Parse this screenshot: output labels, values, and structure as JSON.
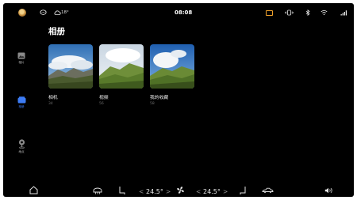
{
  "status_bar": {
    "time": "08:08",
    "weather_temp": "18°",
    "icons": [
      "avatar",
      "messages-icon",
      "weather-icon",
      "dashcam-icon",
      "vibrate-icon",
      "bluetooth-icon",
      "wifi-icon",
      "signal-icon"
    ],
    "accent_dashcam": "#f0a12b"
  },
  "page": {
    "title": "相册"
  },
  "sidebar": {
    "items": [
      {
        "label": "相片",
        "icon": "photo-icon",
        "active": false
      },
      {
        "label": "相册",
        "icon": "album-icon",
        "active": true
      },
      {
        "label": "地点",
        "icon": "location-icon",
        "active": false
      }
    ],
    "active_color": "#3d7cf5"
  },
  "albums": [
    {
      "name": "相机",
      "count": "34"
    },
    {
      "name": "视频",
      "count": "56"
    },
    {
      "name": "我的收藏",
      "count": "58"
    }
  ],
  "dock": {
    "temp_left": "24.5°",
    "temp_right": "24.5°",
    "chevron_left": "<",
    "chevron_right": ">",
    "icons": [
      "home-icon",
      "rear-defrost-icon",
      "seat-left-icon",
      "fan-icon",
      "seat-right-icon",
      "car-icon",
      "volume-icon"
    ]
  }
}
